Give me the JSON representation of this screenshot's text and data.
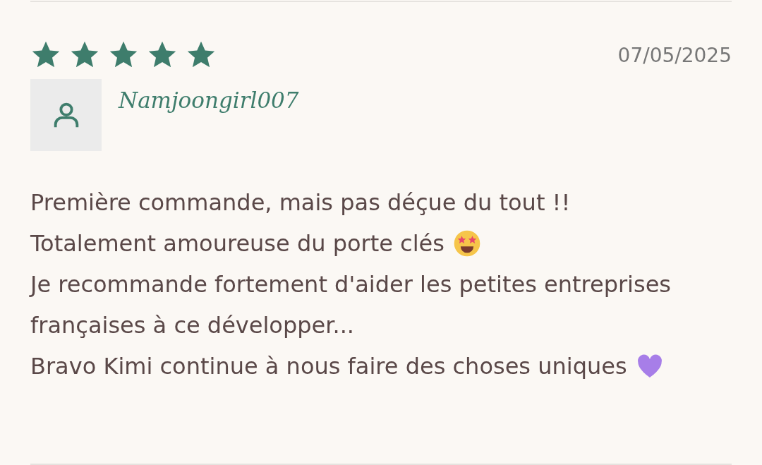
{
  "review": {
    "stars": 5,
    "date": "07/05/2025",
    "author": "Namjoongirl007",
    "lines": [
      {
        "text": "Première commande, mais pas déçue du tout !!"
      },
      {
        "text": "Totalement amoureuse du porte clés",
        "kind": "starstruck"
      },
      {
        "text": "Je recommande fortement d'aider les petites entreprises"
      },
      {
        "text": "françaises à ce développer..."
      },
      {
        "text": "Bravo Kimi continue à nous faire des choses uniques",
        "kind": "heart"
      }
    ]
  }
}
